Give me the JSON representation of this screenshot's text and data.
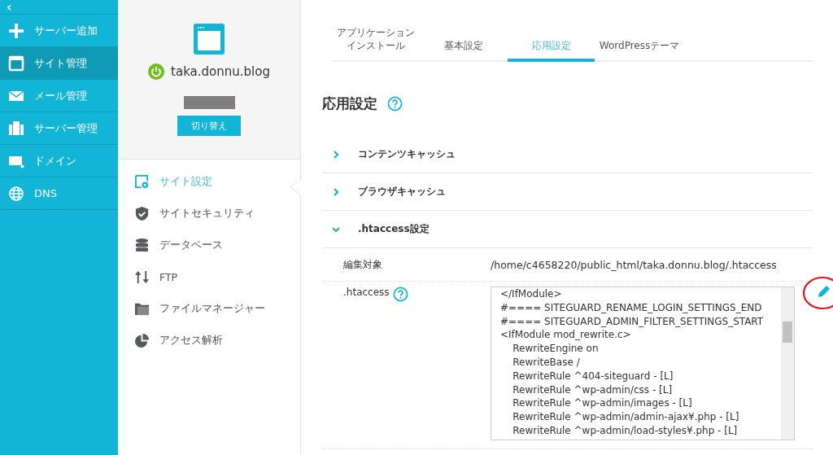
{
  "nav": {
    "collapse": "‹",
    "items": [
      {
        "label": "サーバー追加",
        "selected": false
      },
      {
        "label": "サイト管理",
        "selected": true
      },
      {
        "label": "メール管理",
        "selected": false
      },
      {
        "label": "サーバー管理",
        "selected": false
      },
      {
        "label": "ドメイン",
        "selected": false
      },
      {
        "label": "DNS",
        "selected": false
      }
    ]
  },
  "site": {
    "name": "taka.donnu.blog",
    "on": true,
    "switch_button": "切り替え"
  },
  "site_menu": [
    {
      "label": "サイト設定",
      "selected": true
    },
    {
      "label": "サイトセキュリティ",
      "selected": false
    },
    {
      "label": "データベース",
      "selected": false
    },
    {
      "label": "FTP",
      "selected": false
    },
    {
      "label": "ファイルマネージャー",
      "selected": false
    },
    {
      "label": "アクセス解析",
      "selected": false
    }
  ],
  "tabs": [
    {
      "label": "アプリケーションインストール",
      "selected": false
    },
    {
      "label": "基本設定",
      "selected": false
    },
    {
      "label": "応用設定",
      "selected": true
    },
    {
      "label": "WordPressテーマ",
      "selected": false
    }
  ],
  "heading": "応用設定",
  "sections": [
    {
      "title": "コンテンツキャッシュ",
      "expanded": false
    },
    {
      "title": "ブラウザキャッシュ",
      "expanded": false
    },
    {
      "title": ".htaccess設定",
      "expanded": true
    }
  ],
  "htaccess": {
    "target_label": "編集対象",
    "target_path": "/home/c4658220/public_html/taka.donnu.blog/.htaccess",
    "editor_label": ".htaccess",
    "lines": [
      "</IfModule>",
      "#==== SITEGUARD_RENAME_LOGIN_SETTINGS_END",
      "#==== SITEGUARD_ADMIN_FILTER_SETTINGS_START",
      "<IfModule mod_rewrite.c>",
      "    RewriteEngine on",
      "    RewriteBase /",
      "    RewriteRule ^404-siteguard - [L]",
      "    RewriteRule ^wp-admin/css - [L]",
      "    RewriteRule ^wp-admin/images - [L]",
      "    RewriteRule ^wp-admin/admin-ajax¥.php - [L]",
      "    RewriteRule ^wp-admin/load-styles¥.php - [L]"
    ]
  }
}
